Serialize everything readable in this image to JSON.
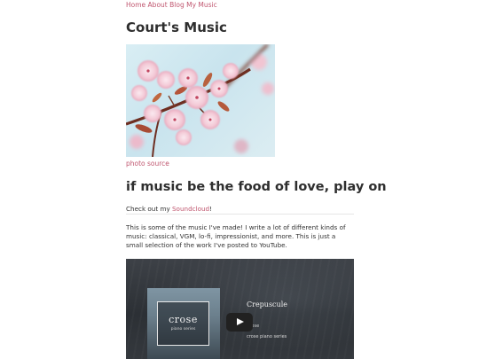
{
  "nav": {
    "items": [
      {
        "label": "Home"
      },
      {
        "label": "About"
      },
      {
        "label": "Blog"
      },
      {
        "label": "My Music"
      }
    ]
  },
  "site_title": "Court's Music",
  "hero": {
    "photo_source_label": "photo source"
  },
  "tagline": "if music be the food of love, play on",
  "checkout": {
    "prefix": "Check out my ",
    "link_label": "Soundcloud",
    "suffix": "!"
  },
  "description": "This is some of the music I've made! I write a lot of different kinds of music: classical, VGM, lo-fi, impressionist, and more. This is just a small selection of the work I've posted to YouTube.",
  "video": {
    "album_title": "crose",
    "album_subtitle": "piano series",
    "track_title": "Crepuscule",
    "artist": "Crose",
    "series": "crose piano series"
  },
  "colors": {
    "link": "#c0566f",
    "heading": "#2e2e2e"
  }
}
